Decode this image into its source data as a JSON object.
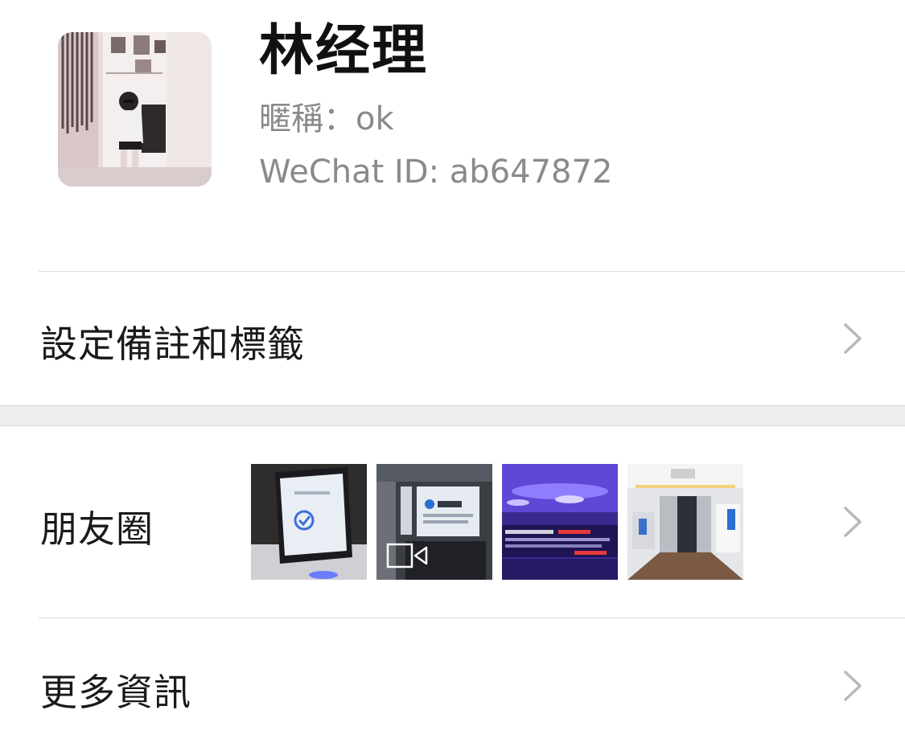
{
  "profile": {
    "display_name": "林经理",
    "nickname_line": "暱稱：ok",
    "wechat_id_line": "WeChat ID: ab647872"
  },
  "rows": {
    "remarks_tags": {
      "label": "設定備註和標籤",
      "icon": "chevron-right-icon"
    },
    "moments": {
      "label": "朋友圈",
      "icon": "chevron-right-icon",
      "thumbnails": [
        {
          "name": "payment-terminal-photo"
        },
        {
          "name": "office-logo-wall-video",
          "badge_icon": "video-camera-icon"
        },
        {
          "name": "conference-hall-photo"
        },
        {
          "name": "office-interior-photo"
        }
      ]
    },
    "more_info": {
      "label": "更多資訊",
      "icon": "chevron-right-icon"
    }
  },
  "colors": {
    "name_text": "#111111",
    "meta_text": "#8a8a8a",
    "row_text": "#1a1a1a",
    "chevron": "#b8b8b8",
    "section_gap": "#ededed",
    "divider": "#dcdcdc"
  }
}
